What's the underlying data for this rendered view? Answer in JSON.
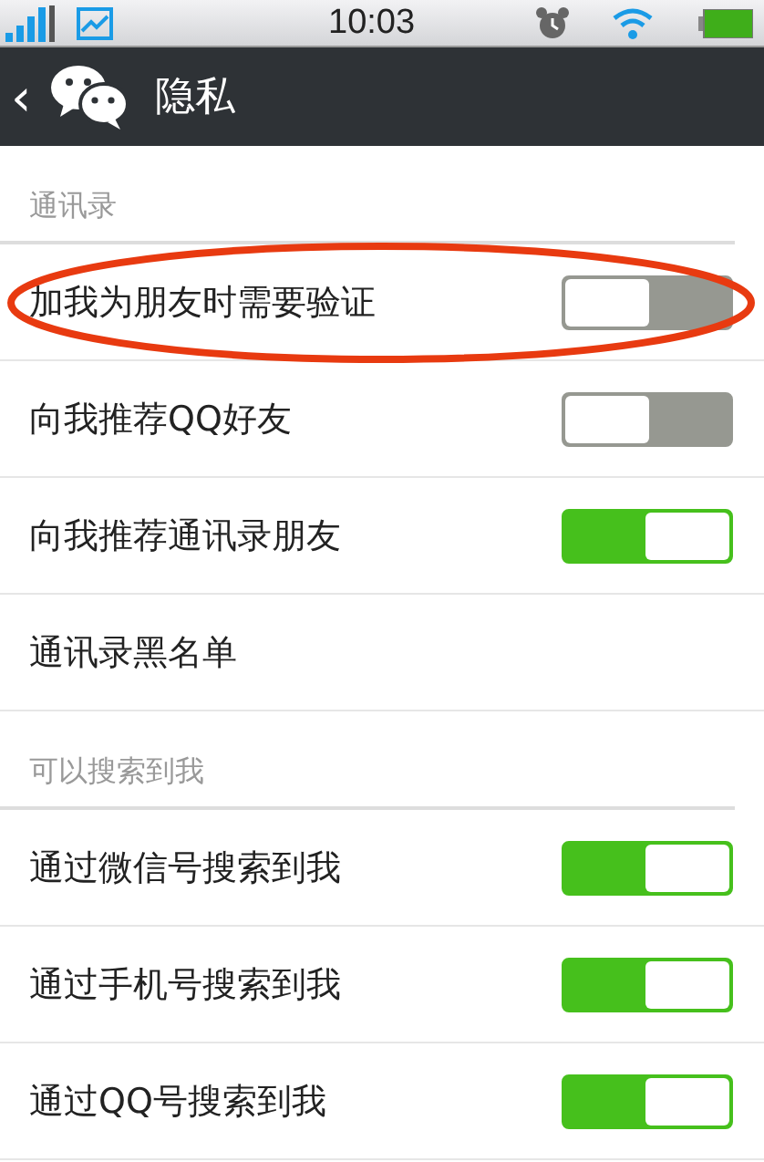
{
  "status_bar": {
    "time": "10:03"
  },
  "nav": {
    "title": "隐私",
    "back": "‹"
  },
  "sections": [
    {
      "title": "通讯录",
      "rows": [
        {
          "kind": "toggle",
          "label": "加我为朋友时需要验证",
          "on": false,
          "highlighted": true
        },
        {
          "kind": "toggle",
          "label": "向我推荐QQ好友",
          "on": false,
          "highlighted": false
        },
        {
          "kind": "toggle",
          "label": "向我推荐通讯录朋友",
          "on": true,
          "highlighted": false
        },
        {
          "kind": "link",
          "label": "通讯录黑名单"
        }
      ]
    },
    {
      "title": "可以搜索到我",
      "rows": [
        {
          "kind": "toggle",
          "label": "通过微信号搜索到我",
          "on": true,
          "highlighted": false
        },
        {
          "kind": "toggle",
          "label": "通过手机号搜索到我",
          "on": true,
          "highlighted": false
        },
        {
          "kind": "toggle",
          "label": "通过QQ号搜索到我",
          "on": true,
          "highlighted": false
        }
      ]
    }
  ]
}
